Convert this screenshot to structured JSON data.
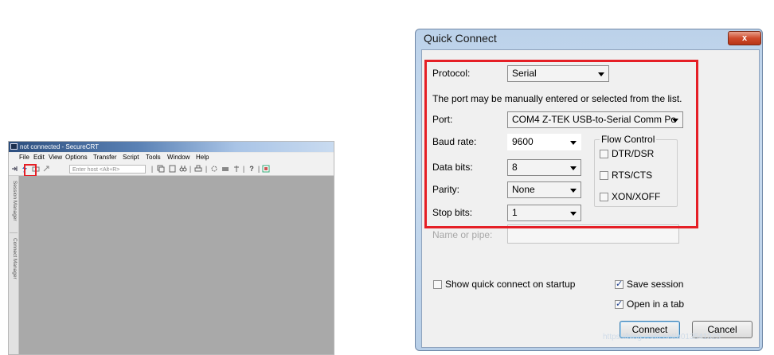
{
  "securecrt": {
    "title": "not connected - SecureCRT",
    "menu": [
      "File",
      "Edit",
      "View",
      "Options",
      "Transfer",
      "Script",
      "Tools",
      "Window",
      "Help"
    ],
    "host_placeholder": "Enter host <Alt+R>",
    "side_tabs": [
      "Session Manager",
      "Connect Manager"
    ],
    "toolbar_icons": [
      "connect-icon",
      "quick-connect-icon",
      "tab-icon",
      "reconnect-icon",
      "copy-icon",
      "paste-icon",
      "find-icon",
      "print-icon",
      "settings-icon",
      "keymap-icon",
      "sftp-icon",
      "help-icon",
      "options-icon"
    ],
    "colors": {
      "highlight": "#e51f26",
      "workspace": "#a9a9a9"
    }
  },
  "quick_connect": {
    "title": "Quick Connect",
    "close_label": "x",
    "protocol_label": "Protocol:",
    "protocol_value": "Serial",
    "note": "The port may be manually entered or selected from the list.",
    "port_label": "Port:",
    "port_value": "COM4 Z-TEK USB-to-Serial Comm Po",
    "baud_label": "Baud rate:",
    "baud_value": "9600",
    "databits_label": "Data bits:",
    "databits_value": "8",
    "parity_label": "Parity:",
    "parity_value": "None",
    "stopbits_label": "Stop bits:",
    "stopbits_value": "1",
    "flow_control": {
      "caption": "Flow Control",
      "items": [
        {
          "label": "DTR/DSR",
          "checked": false
        },
        {
          "label": "RTS/CTS",
          "checked": false
        },
        {
          "label": "XON/XOFF",
          "checked": false
        }
      ]
    },
    "pipe_label": "Name or pipe:",
    "show_on_startup": {
      "label": "Show quick connect on startup",
      "checked": false
    },
    "save_session": {
      "label": "Save session",
      "checked": true
    },
    "open_in_tab": {
      "label": "Open in a tab",
      "checked": true
    },
    "connect_label": "Connect",
    "cancel_label": "Cancel",
    "colors": {
      "highlight": "#e51f26",
      "frame": "#bcd2ea",
      "close": "#cf4b2c"
    }
  },
  "watermark": "https://blog.csdn.net/u013541325"
}
